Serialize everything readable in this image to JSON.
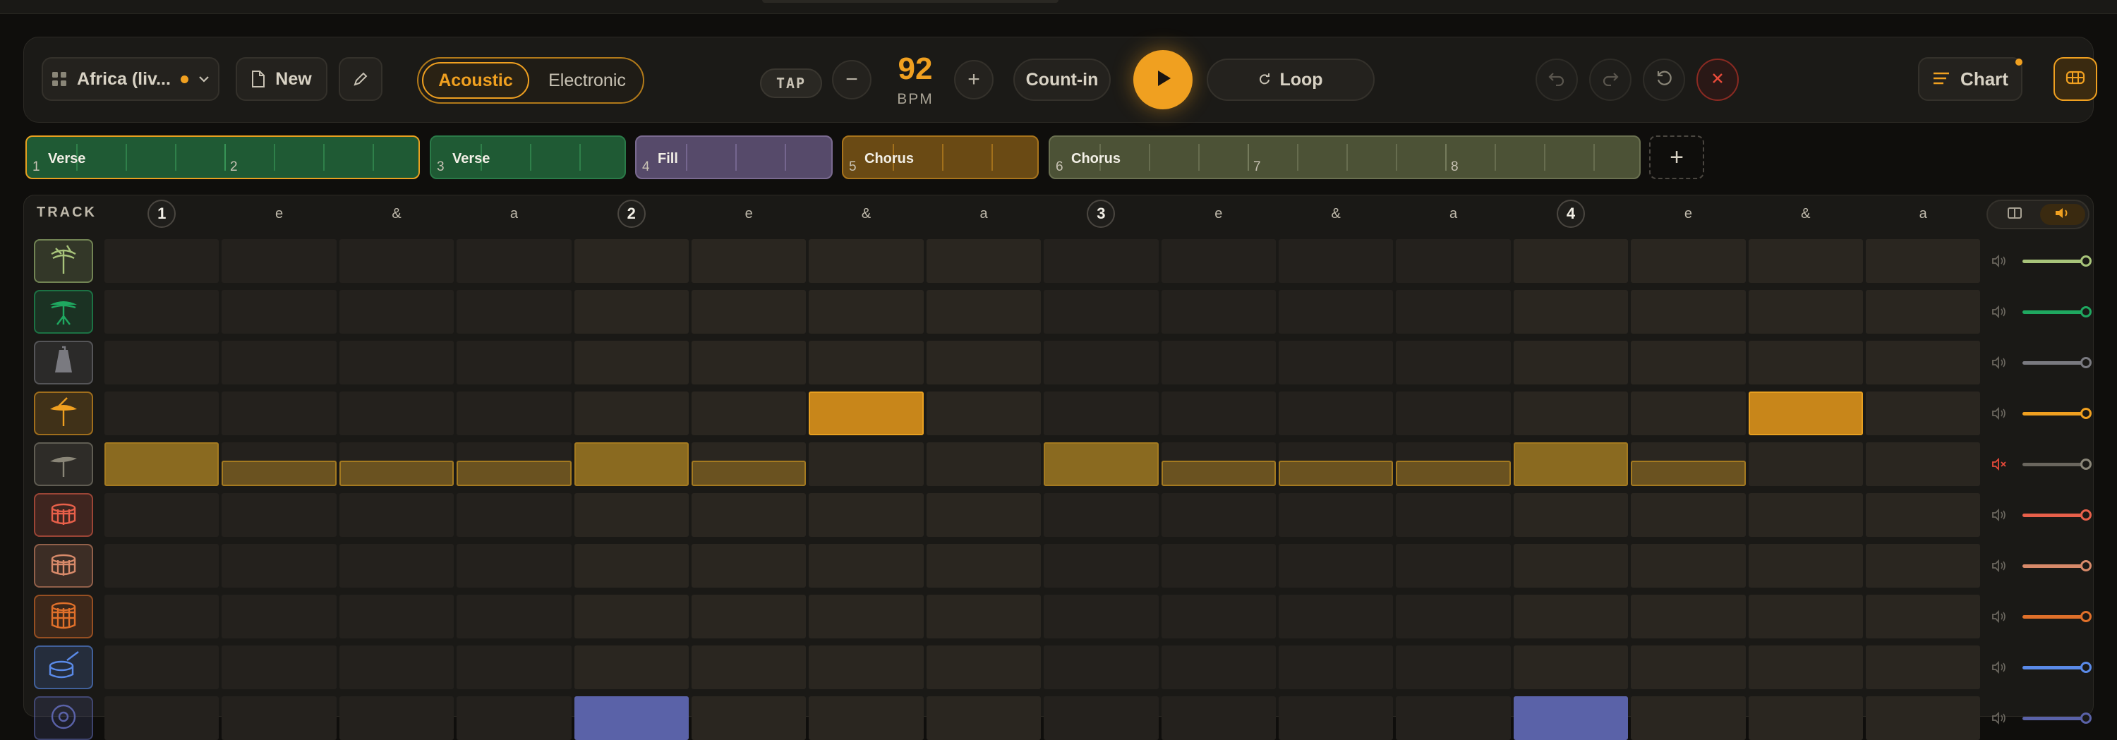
{
  "toolbar": {
    "song_name": "Africa (liv...",
    "new_label": "New",
    "kits": [
      "Acoustic",
      "Electronic"
    ],
    "active_kit": "Acoustic",
    "tap_label": "TAP",
    "bpm_value": "92",
    "bpm_label": "BPM",
    "minus": "−",
    "plus": "+",
    "count_in_label": "Count-in",
    "loop_label": "Loop",
    "chart_label": "Chart"
  },
  "sections": [
    {
      "name": "Verse",
      "bars": [
        "1",
        "2"
      ],
      "color": "#1f5a34"
    },
    {
      "name": "Verse",
      "bars": [
        "3"
      ],
      "color": "#1f5a34"
    },
    {
      "name": "Fill",
      "bars": [
        "4"
      ],
      "color": "#564a6a"
    },
    {
      "name": "Chorus",
      "bars": [
        "5"
      ],
      "color": "#6a4a14"
    },
    {
      "name": "Chorus",
      "bars": [
        "6",
        "7",
        "8"
      ],
      "color": "#4c5236"
    }
  ],
  "add_section": "+",
  "grid": {
    "track_header": "TRACK",
    "beats": [
      "1",
      "2",
      "3",
      "4"
    ],
    "subdivisions": [
      "e",
      "&",
      "a"
    ]
  },
  "tracks": [
    {
      "icon": "hihat-open-icon",
      "color": "#a8c47a",
      "steps": "0000000000000000",
      "muted": false,
      "volume": 1.0
    },
    {
      "icon": "hihat-closed-icon",
      "color": "#1fa860",
      "steps": "0000000000000000",
      "muted": false,
      "volume": 1.0
    },
    {
      "icon": "cowbell-icon",
      "color": "#7a7a80",
      "steps": "0000000000000000",
      "muted": false,
      "volume": 1.0
    },
    {
      "icon": "ride-cymbal-icon",
      "color": "#f0a020",
      "steps": "0000001000000010",
      "muted": false,
      "volume": 1.0
    },
    {
      "icon": "crash-cymbal-icon",
      "color": "#8a8678",
      "steps": "2111210021112100",
      "muted": true,
      "volume": 1.0
    },
    {
      "icon": "tom-high-icon",
      "color": "#e8604a",
      "steps": "0000000000000000",
      "muted": false,
      "volume": 1.0
    },
    {
      "icon": "tom-mid-icon",
      "color": "#d88a6a",
      "steps": "0000000000000000",
      "muted": false,
      "volume": 1.0
    },
    {
      "icon": "floor-tom-icon",
      "color": "#e0702a",
      "steps": "0000000000000000",
      "muted": false,
      "volume": 1.0
    },
    {
      "icon": "snare-icon",
      "color": "#5a8ae8",
      "steps": "0000000000000000",
      "muted": false,
      "volume": 1.0
    },
    {
      "icon": "kick-icon",
      "color": "#5a62a8",
      "steps": "0000100000001000",
      "muted": false,
      "volume": 1.0
    }
  ]
}
